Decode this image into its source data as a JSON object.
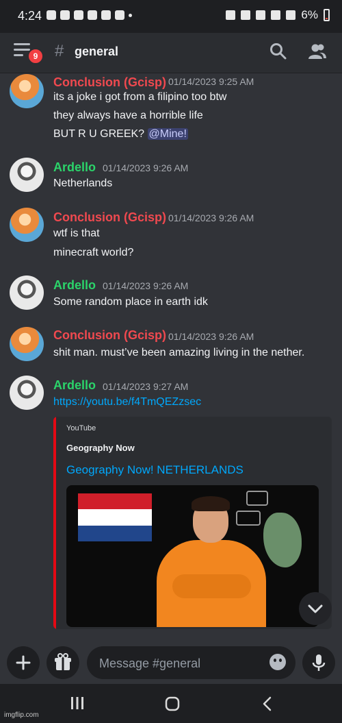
{
  "status_bar": {
    "time": "4:24",
    "battery": "6%",
    "icons": [
      "discord-icon",
      "discord-icon",
      "clipboard-icon",
      "twitter-icon",
      "account-icon",
      "voicemail-icon",
      "edit-icon",
      "alarm-icon",
      "mute-icon",
      "wifi-icon",
      "signal-icon",
      "battery-icon"
    ]
  },
  "header": {
    "menu_badge": "9",
    "hash": "#",
    "channel": "general"
  },
  "messages": [
    {
      "author": "Conclusion (Gcisp)",
      "timestamp": "01/14/2023 9:25 AM",
      "lines": [
        "its a joke i got from a filipino too btw",
        "they always have a horrible life"
      ],
      "mention_line_prefix": "BUT R U GREEK?",
      "mention": "@Mine!"
    },
    {
      "author": "Ardello",
      "timestamp": "01/14/2023 9:26 AM",
      "lines": [
        "Netherlands"
      ]
    },
    {
      "author": "Conclusion (Gcisp)",
      "timestamp": "01/14/2023 9:26 AM",
      "lines": [
        "wtf is that",
        "minecraft world?"
      ]
    },
    {
      "author": "Ardello",
      "timestamp": "01/14/2023 9:26 AM",
      "lines": [
        "Some random place in earth idk"
      ]
    },
    {
      "author": "Conclusion (Gcisp)",
      "timestamp": "01/14/2023 9:26 AM",
      "lines": [
        "shit man. must’ve been amazing living in the nether."
      ]
    },
    {
      "author": "Ardello",
      "timestamp": "01/14/2023 9:27 AM",
      "link": "https://youtu.be/f4TmQEZzsec"
    }
  ],
  "embed": {
    "provider": "YouTube",
    "author": "Geography Now",
    "title": "Geography Now! NETHERLANDS",
    "accent": "#e50914"
  },
  "composer": {
    "placeholder": "Message #general"
  },
  "footer": {
    "watermark": "imgflip.com"
  },
  "colors": {
    "red_user": "#f0494f",
    "green_user": "#2bd46a",
    "link": "#00a8fc"
  }
}
